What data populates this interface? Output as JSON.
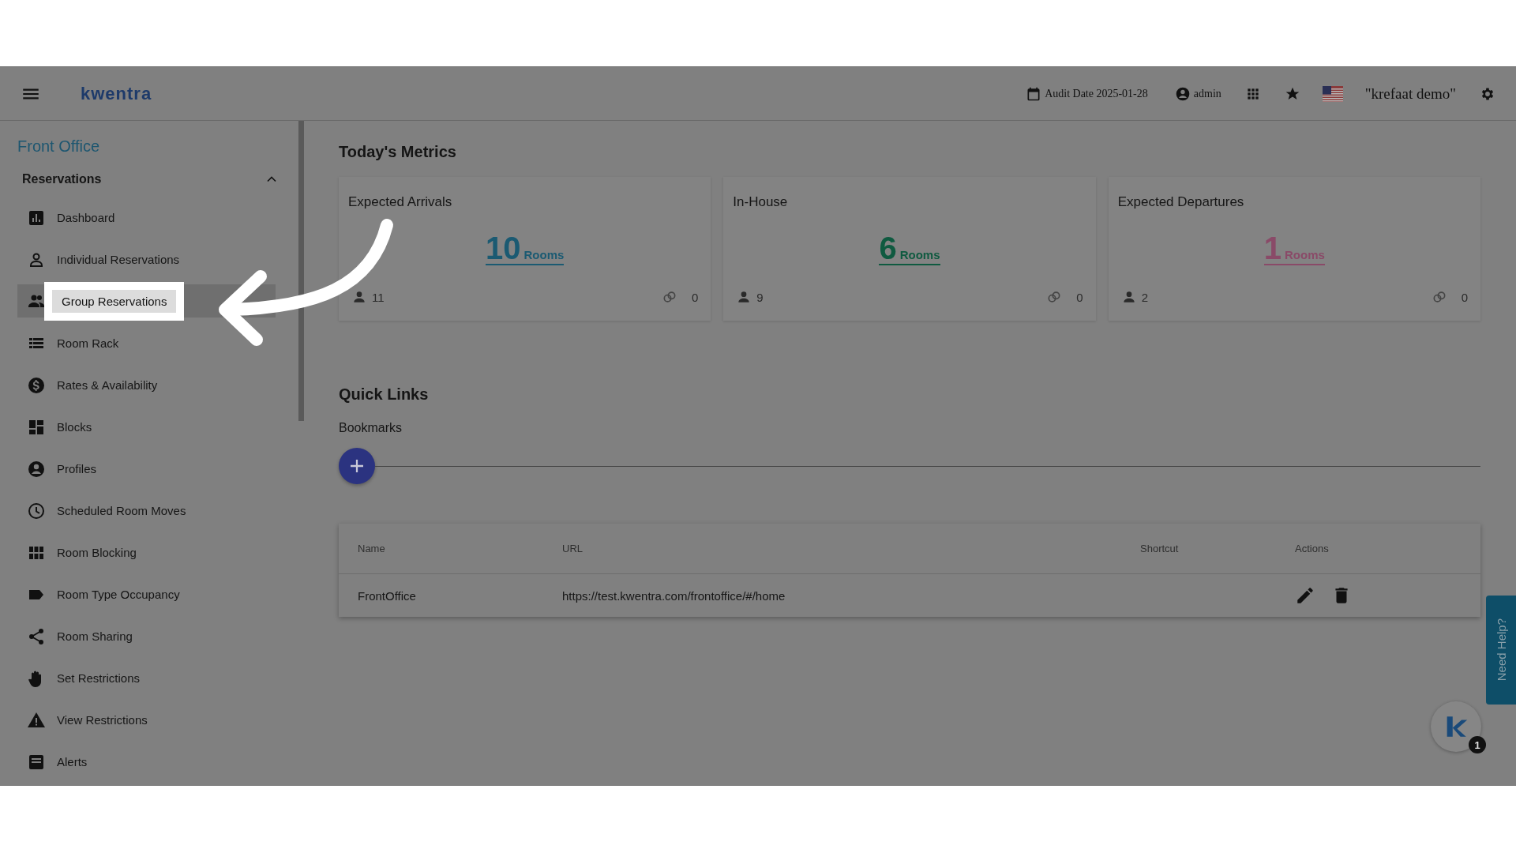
{
  "header": {
    "logo": "kwentra",
    "audit_date": "Audit Date 2025-01-28",
    "user": "admin",
    "company": "\"krefaat demo\""
  },
  "sidebar": {
    "title": "Front Office",
    "section": {
      "label": "Reservations",
      "expanded": true
    },
    "items": [
      {
        "label": "Dashboard",
        "selected": false
      },
      {
        "label": "Individual Reservations",
        "selected": false
      },
      {
        "label": "Group Reservations",
        "selected": true
      },
      {
        "label": "Room Rack",
        "selected": false
      },
      {
        "label": "Rates & Availability",
        "selected": false
      },
      {
        "label": "Blocks",
        "selected": false
      },
      {
        "label": "Profiles",
        "selected": false
      },
      {
        "label": "Scheduled Room Moves",
        "selected": false
      },
      {
        "label": "Room Blocking",
        "selected": false
      },
      {
        "label": "Room Type Occupancy",
        "selected": false
      },
      {
        "label": "Room Sharing",
        "selected": false
      },
      {
        "label": "Set Restrictions",
        "selected": false
      },
      {
        "label": "View Restrictions",
        "selected": false
      },
      {
        "label": "Alerts",
        "selected": false
      }
    ]
  },
  "metrics": {
    "title": "Today's Metrics",
    "cards": [
      {
        "title": "Expected Arrivals",
        "count": "10",
        "unit": "Rooms",
        "guests": "11",
        "shared": "0",
        "color": "#1b5a72"
      },
      {
        "title": "In-House",
        "count": "6",
        "unit": "Rooms",
        "guests": "9",
        "shared": "0",
        "color": "#0f5a40"
      },
      {
        "title": "Expected Departures",
        "count": "1",
        "unit": "Rooms",
        "guests": "2",
        "shared": "0",
        "color": "#8a4a68"
      }
    ]
  },
  "quick_links": {
    "title": "Quick Links",
    "subtitle": "Bookmarks",
    "table": {
      "columns": [
        "Name",
        "URL",
        "Shortcut",
        "Actions"
      ],
      "rows": [
        {
          "name": "FrontOffice",
          "url": "https://test.kwentra.com/frontoffice/#/home"
        }
      ]
    }
  },
  "help": "Need Help?",
  "chat_badge": "1"
}
